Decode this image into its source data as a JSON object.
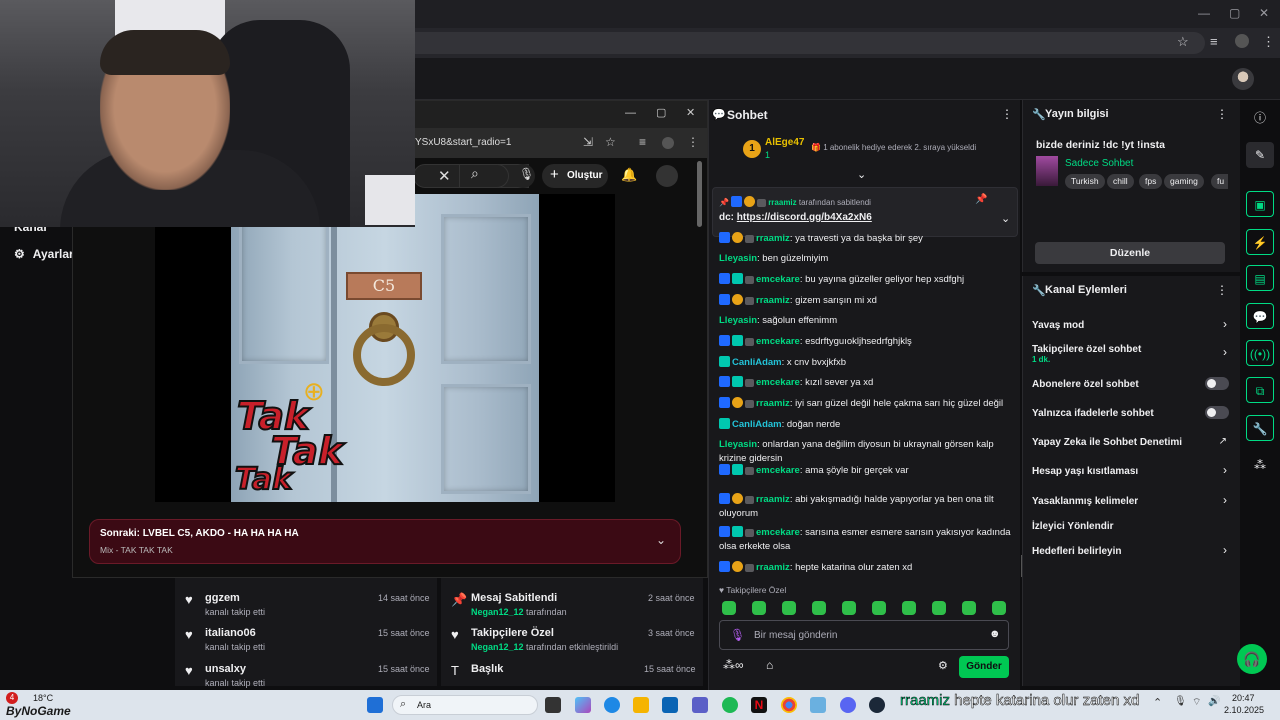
{
  "yt": {
    "url_fragment": "YSxU8&start_radio=1",
    "create_label": "Oluştur",
    "plate_text": "C5",
    "tak_text": [
      "Tak",
      "Tak",
      "Tak"
    ],
    "next_title": "Sonraki: LVBEL C5, AKDO - HA HA HA HA",
    "next_sub": "Mix - TAK TAK TAK"
  },
  "nav": {
    "kanal": "Kanal",
    "ayarlar": "Ayarlar"
  },
  "feeds": {
    "left": [
      {
        "title": "ggzem",
        "sub": "kanalı takip etti",
        "time": "14 saat önce"
      },
      {
        "title": "italiano06",
        "sub": "kanalı takip etti",
        "time": "15 saat önce"
      },
      {
        "title": "unsalxy",
        "sub": "kanalı takip etti",
        "time": "15 saat önce"
      }
    ],
    "right": [
      {
        "title": "Mesaj Sabitlendi",
        "user": "Negan12_12",
        "rest": " tarafından",
        "time": "2 saat önce"
      },
      {
        "title": "Takipçilere Özel",
        "user": "Negan12_12",
        "rest": " tarafından etkinleştirildi",
        "time": "3 saat önce"
      },
      {
        "title": "Başlık",
        "user": "",
        "rest": "",
        "time": "15 saat önce"
      }
    ]
  },
  "chat": {
    "title": "Sohbet",
    "leader_rank": "1",
    "leader_name": "AlEge47",
    "leader_count": "1",
    "leader_msg": "1 abonelik hediye ederek 2. sıraya yükseldi",
    "pinned_by_user": "rraamiz",
    "pinned_by_rest": " tarafından sabitlendi",
    "pinned_text": "dc: ",
    "pinned_link": "https://discord.gg/b4Xa2xN6",
    "messages": [
      {
        "user": "rraamiz",
        "cls": "u-green",
        "badges": "mod-gold-gray",
        "text": ": ya travesti ya da başka bir şey"
      },
      {
        "user": "Lleyasin",
        "cls": "u-green",
        "badges": "",
        "text": ": ben güzelmiyim"
      },
      {
        "user": "emcekare",
        "cls": "u-green",
        "badges": "mod-sub-gray",
        "text": ": bu yayına güzeller geliyor hep xsdfghj"
      },
      {
        "user": "rraamiz",
        "cls": "u-green",
        "badges": "mod-gold-gray",
        "text": ": gizem sarışın mi xd"
      },
      {
        "user": "Lleyasin",
        "cls": "u-green",
        "badges": "",
        "text": ": sağolun effenimm"
      },
      {
        "user": "emcekare",
        "cls": "u-green",
        "badges": "mod-sub-gray",
        "text": ": esdrftyguıoklјhsedrfghjklş"
      },
      {
        "user": "CanliAdam",
        "cls": "u-cyan",
        "badges": "sub",
        "text": ": x cnv bvxjkfxb"
      },
      {
        "user": "emcekare",
        "cls": "u-green",
        "badges": "mod-sub-gray",
        "text": ": kızıl sever ya xd"
      },
      {
        "user": "rraamiz",
        "cls": "u-green",
        "badges": "mod-gold-gray",
        "text": ": iyi sarı güzel değil hele çakma sarı hiç güzel değil"
      },
      {
        "user": "CanliAdam",
        "cls": "u-cyan",
        "badges": "sub",
        "text": ": doğan nerde"
      },
      {
        "user": "Lleyasin",
        "cls": "u-green",
        "badges": "",
        "text": ": onlardan yana değilim diyosun bi ukraynalı görsen kalp krizine gidersin"
      },
      {
        "user": "emcekare",
        "cls": "u-green",
        "badges": "mod-sub-gray",
        "text": ": ama şöyle bir gerçek var"
      },
      {
        "user": "rraamiz",
        "cls": "u-green",
        "badges": "mod-gold-gray",
        "text": ": abi yakışmadığı halde yapıyorlar ya ben ona tilt oluyorum"
      },
      {
        "user": "emcekare",
        "cls": "u-green",
        "badges": "mod-sub-gray",
        "text": ": sarısına esmer esmere sarısın yakısıyor kadında olsa erkekte olsa"
      },
      {
        "user": "rraamiz",
        "cls": "u-green",
        "badges": "mod-gold-gray",
        "text": ": hepte katarina olur zaten xd"
      }
    ],
    "followers_only": "Takipçilere Özel",
    "input_placeholder": "Bir mesaj gönderin",
    "send_label": "Gönder"
  },
  "info": {
    "title": "Yayın bilgisi",
    "stream_title": "bizde deriniz !dc !yt !insta",
    "category": "Sadece Sohbet",
    "tags": [
      "Turkish",
      "chill",
      "fps",
      "gaming",
      "fu"
    ],
    "edit_label": "Düzenle"
  },
  "actions": {
    "title": "Kanal Eylemleri",
    "items": [
      {
        "label": "Yavaş mod",
        "sub": "",
        "ctl": "chevron"
      },
      {
        "label": "Takipçilere özel sohbet",
        "sub": "1 dk.",
        "ctl": "chevron"
      },
      {
        "label": "Abonelere özel sohbet",
        "sub": "",
        "ctl": "toggle"
      },
      {
        "label": "Yalnızca ifadelerle sohbet",
        "sub": "",
        "ctl": "toggle"
      },
      {
        "label": "Yapay Zeka ile Sohbet Denetimi",
        "sub": "",
        "ctl": "external"
      },
      {
        "label": "Hesap yaşı kısıtlaması",
        "sub": "",
        "ctl": "chevron"
      },
      {
        "label": "Yasaklanmış kelimeler",
        "sub": "",
        "ctl": "chevron"
      },
      {
        "label": "İzleyici Yönlendir",
        "sub": "",
        "ctl": "none"
      },
      {
        "label": "Hedefleri belirleyin",
        "sub": "",
        "ctl": "chevron"
      }
    ]
  },
  "taskbar": {
    "temp": "18°C",
    "watermark": "ByNoGame",
    "search": "Ara",
    "ticker_user": "rraamiz",
    "ticker_text": " hepte katarina olur zaten xd",
    "time": "20:47",
    "date": "2.10.2025",
    "notif": "4"
  }
}
